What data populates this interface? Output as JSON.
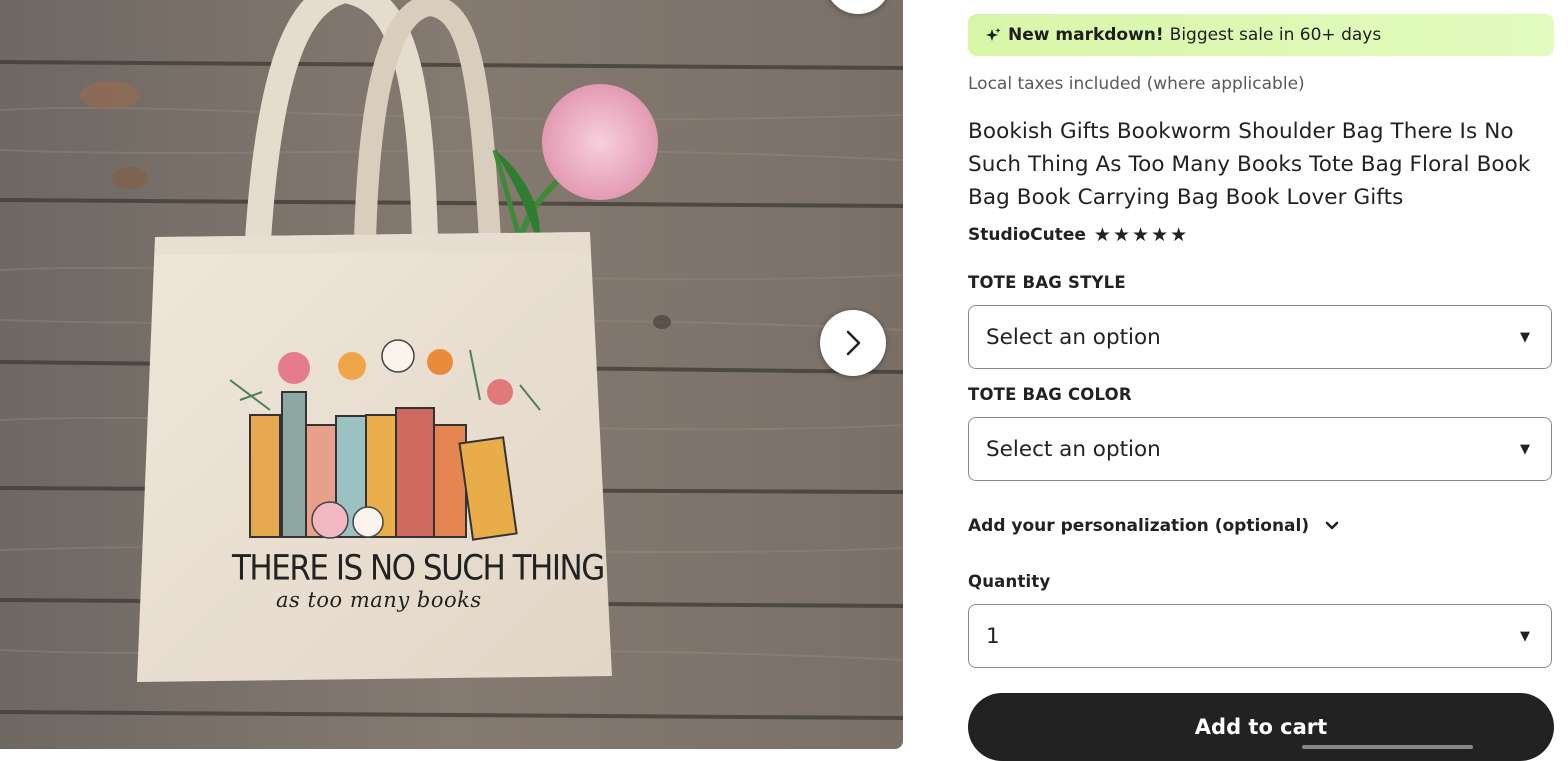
{
  "gallery": {
    "bag_print_line1": "THERE IS NO SUCH THING",
    "bag_print_line2": "as too many books"
  },
  "promo": {
    "icon": "sparkle-icon",
    "bold": "New markdown!",
    "text": "Biggest sale in 60+ days"
  },
  "taxes_note": "Local taxes included (where applicable)",
  "product_title": "Bookish Gifts Bookworm Shoulder Bag There Is No Such Thing As Too Many Books Tote Bag Floral Book Bag Book Carrying Bag Book Lover Gifts",
  "shop": {
    "name": "StudioCutee",
    "rating": 5
  },
  "options": {
    "style_label": "TOTE BAG STYLE",
    "style_value": "Select an option",
    "color_label": "TOTE BAG COLOR",
    "color_value": "Select an option"
  },
  "personalization_label": "Add your personalization (optional)",
  "quantity": {
    "label": "Quantity",
    "value": "1"
  },
  "add_to_cart_label": "Add to cart",
  "colors": {
    "promo_bg": "#d8f6a8",
    "button_bg": "#222222"
  }
}
